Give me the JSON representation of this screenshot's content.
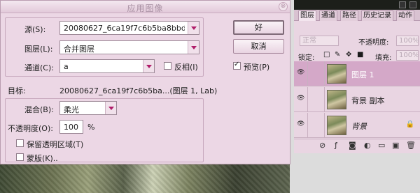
{
  "dialog": {
    "title": "应用图像",
    "close_glyph": "⊗",
    "source": {
      "label": "源(S):",
      "value": "20080627_6ca19f7c6b5ba8bbd3..."
    },
    "layer": {
      "label": "图层(L):",
      "value": "合并图层"
    },
    "channel": {
      "label": "通道(C):",
      "value": "a"
    },
    "invert": {
      "label": "反相(I)",
      "checked": false
    },
    "target": {
      "label": "目标:",
      "value": "20080627_6ca19f7c6b5ba...(图层 1, Lab)"
    },
    "blending": {
      "label": "混合(B):",
      "value": "柔光"
    },
    "opacity": {
      "label": "不透明度(O):",
      "value": "100",
      "unit": "%"
    },
    "preserve_transparency": {
      "label": "保留透明区域(T)",
      "checked": false
    },
    "mask": {
      "label": "蒙版(K)..",
      "checked": false
    },
    "ok_label": "好",
    "cancel_label": "取消",
    "preview": {
      "label": "预览(P)",
      "checked": true
    }
  },
  "layers_panel": {
    "tabs": [
      "图层",
      "通道",
      "路径",
      "历史记录",
      "动作"
    ],
    "blend_mode": "正常",
    "opacity_label": "不透明度:",
    "opacity_value": "100%",
    "lock_label": "锁定:",
    "fill_label": "填充:",
    "fill_value": "100%",
    "layers": [
      {
        "name": "图层 1",
        "selected": true
      },
      {
        "name": "背景 副本",
        "selected": false
      },
      {
        "name": "背景",
        "selected": false,
        "locked": true
      }
    ]
  }
}
